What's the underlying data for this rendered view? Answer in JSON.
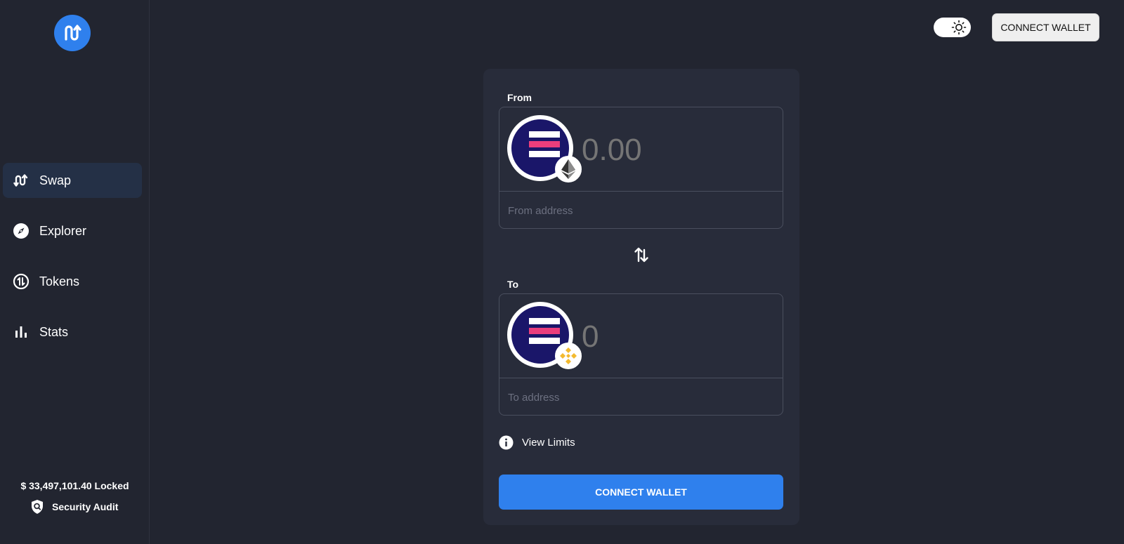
{
  "sidebar": {
    "logo_icon": "bridge-swap-logo-icon",
    "items": [
      {
        "label": "Swap",
        "icon": "swap-arrows-icon",
        "active": true
      },
      {
        "label": "Explorer",
        "icon": "compass-icon",
        "active": false
      },
      {
        "label": "Tokens",
        "icon": "tokens-exchange-icon",
        "active": false
      },
      {
        "label": "Stats",
        "icon": "bar-chart-icon",
        "active": false
      }
    ],
    "locked_text": "$ 33,497,101.40 Locked",
    "audit_label": "Security Audit",
    "audit_icon": "shield-search-icon"
  },
  "header": {
    "theme_icon": "sun-icon",
    "connect_label": "CONNECT WALLET"
  },
  "swap": {
    "from": {
      "label": "From",
      "amount": "0.00",
      "address_placeholder": "From address",
      "token_icon": "token-logo-icon",
      "chain_icon": "ethereum-icon"
    },
    "to": {
      "label": "To",
      "amount": "0",
      "address_placeholder": "To address",
      "token_icon": "token-logo-icon",
      "chain_icon": "binance-icon"
    },
    "direction_icon": "swap-direction-icon",
    "limits_label": "View Limits",
    "limits_icon": "info-icon",
    "connect_label": "CONNECT WALLET"
  },
  "colors": {
    "background": "#222530",
    "card": "#282c3a",
    "accent": "#2f80ed",
    "active_nav": "#243046",
    "token_navy": "#1a1669",
    "token_pink": "#ea3e7c",
    "binance_gold": "#f3ba2f"
  }
}
